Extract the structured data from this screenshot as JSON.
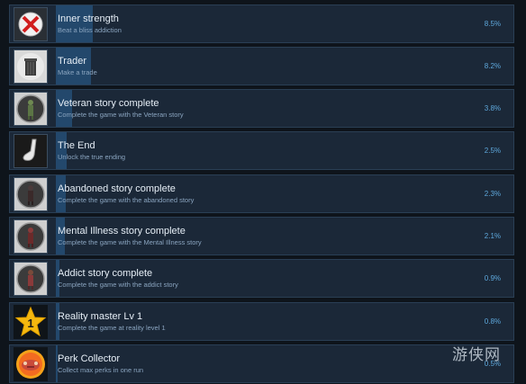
{
  "achievements": [
    {
      "title": "Inner strength",
      "description": "Beat a bliss addiction",
      "percent": "8.5%",
      "percent_value": 8.5,
      "icon": "no-drugs-icon"
    },
    {
      "title": "Trader",
      "description": "Make a trade",
      "percent": "8.2%",
      "percent_value": 8.2,
      "icon": "trash-can-icon"
    },
    {
      "title": "Veteran story complete",
      "description": "Complete the game with the Veteran story",
      "percent": "3.8%",
      "percent_value": 3.8,
      "icon": "veteran-portrait-icon"
    },
    {
      "title": "The End",
      "description": "Unlock the true ending",
      "percent": "2.5%",
      "percent_value": 2.5,
      "icon": "sock-icon"
    },
    {
      "title": "Abandoned story complete",
      "description": "Complete the game with the abandoned story",
      "percent": "2.3%",
      "percent_value": 2.3,
      "icon": "abandoned-portrait-icon"
    },
    {
      "title": "Mental Illness story complete",
      "description": "Complete the game with the Mental Illness story",
      "percent": "2.1%",
      "percent_value": 2.1,
      "icon": "mental-illness-portrait-icon"
    },
    {
      "title": "Addict story complete",
      "description": "Complete the game with the addict story",
      "percent": "0.9%",
      "percent_value": 0.9,
      "icon": "addict-portrait-icon"
    },
    {
      "title": "Reality master Lv 1",
      "description": "Complete the game at reality level 1",
      "percent": "0.8%",
      "percent_value": 0.8,
      "icon": "star-icon",
      "icon_text": "1"
    },
    {
      "title": "Perk Collector",
      "description": "Collect max perks in one run",
      "percent": "0.5%",
      "percent_value": 0.5,
      "icon": "perk-badge-icon"
    }
  ],
  "watermark": "游侠网",
  "colors": {
    "row_bg": "#1b2838",
    "bar_fill": "#23486c",
    "percent": "#5ea8dc",
    "title": "#e6eef6",
    "description": "#8aa4bf"
  }
}
